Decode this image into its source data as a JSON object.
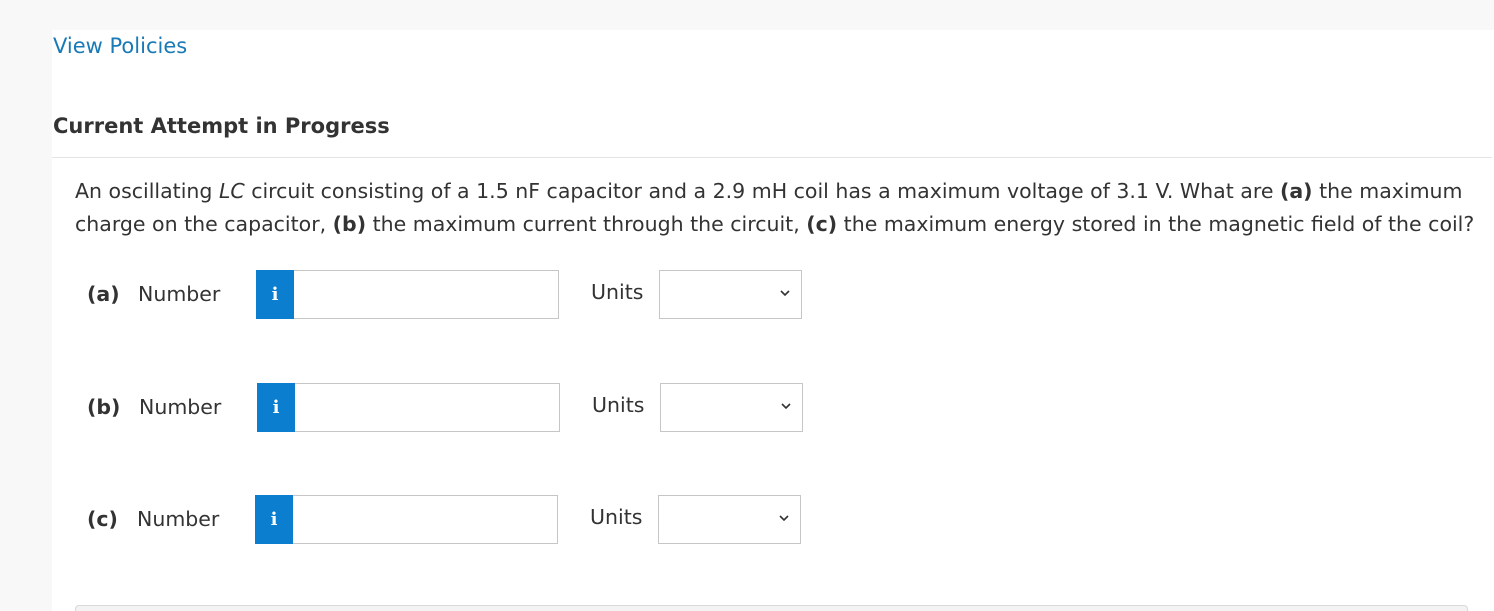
{
  "header": {
    "policies_link": "View Policies",
    "attempt_heading": "Current Attempt in Progress"
  },
  "question": {
    "t1": "An oscillating ",
    "t2": "LC",
    "t3": " circuit consisting of a 1.5 nF capacitor and a 2.9 mH coil has a maximum voltage of 3.1 V. What are ",
    "t4": "(a)",
    "t5": " the maximum charge on the capacitor, ",
    "t6": "(b)",
    "t7": " the maximum current through the circuit, ",
    "t8": "(c)",
    "t9": " the maximum energy stored in the magnetic field of the coil?"
  },
  "parts": [
    {
      "label": "(a)",
      "number_label": "Number",
      "info": "i",
      "value": "",
      "units_label": "Units",
      "units_value": ""
    },
    {
      "label": "(b)",
      "number_label": "Number",
      "info": "i",
      "value": "",
      "units_label": "Units",
      "units_value": ""
    },
    {
      "label": "(c)",
      "number_label": "Number",
      "info": "i",
      "value": "",
      "units_label": "Units",
      "units_value": ""
    }
  ],
  "colors": {
    "link": "#1a7ab5",
    "info_button": "#0c7ed0"
  }
}
